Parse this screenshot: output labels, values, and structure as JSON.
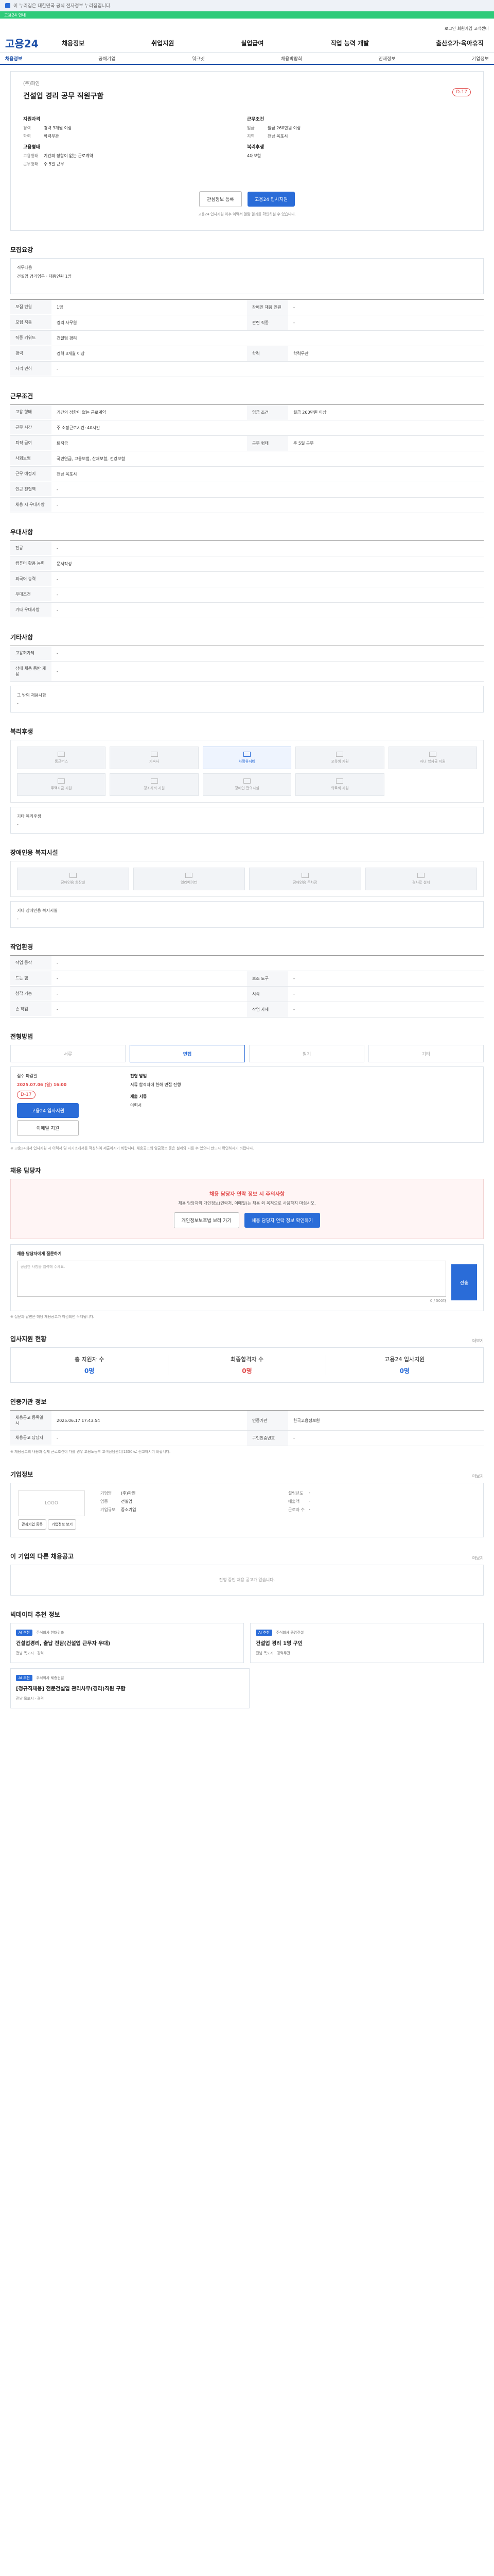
{
  "topbar": {
    "text": "이 누리집은 대한민국 공식 전자정부 누리집입니다."
  },
  "greenbar": {
    "text": "고용24 안내"
  },
  "util": {
    "links": "로그인 회원가입 고객센터"
  },
  "logo": "고용24",
  "gnb": [
    "채용정보",
    "취업지원",
    "실업급여",
    "직업 능력 개발",
    "출산휴가·육아휴직"
  ],
  "subnav": [
    "채용정보",
    "공채기업",
    "워크넷",
    "채용박람회",
    "인재정보",
    "기업정보"
  ],
  "job": {
    "company": "(주)파인",
    "title": "건설업 경리 공무 직원구함",
    "dday": "D-17",
    "left_head": "지원자격",
    "left": [
      {
        "k": "경력",
        "v": "경력 3개월 이상"
      },
      {
        "k": "학력",
        "v": "학력무관"
      }
    ],
    "right_head": "근무조건",
    "right": [
      {
        "k": "임금",
        "v": "월급 260만원 이상"
      },
      {
        "k": "지역",
        "v": "전남 목포시"
      }
    ],
    "left_head2": "고용형태",
    "left2": [
      {
        "k": "고용형태",
        "v": "기간의 정함이 없는 근로계약"
      },
      {
        "k": "근무형태",
        "v": "주 5일 근무"
      }
    ],
    "right_head2": "복리후생",
    "right2": [
      {
        "k": "",
        "v": "4대보험"
      }
    ],
    "btn_scrap": "관심정보 등록",
    "btn_apply": "고용24 입사지원",
    "notice": "고용24 입사지원 이후 이력서 열람 결과를 확인하실 수 있습니다."
  },
  "sec_recruit": {
    "title": "모집요강",
    "desc_label": "직무내용",
    "desc": "건설업 경리업무 · 채용인원 1명",
    "rows": [
      {
        "th": "모집 인원",
        "td": "1명",
        "th2": "장애인 채용 인원",
        "td2": "-"
      },
      {
        "th": "모집 직종",
        "td": "경리 사무원",
        "th2": "관련 직종",
        "td2": "-"
      },
      {
        "th": "직종 키워드",
        "td": "건설업 경리",
        "th2": "",
        "td2": ""
      },
      {
        "th": "경력",
        "td": "경력 3개월 이상",
        "th2": "학력",
        "td2": "학력무관"
      },
      {
        "th": "자격 면허",
        "td": "-",
        "th2": "",
        "td2": ""
      }
    ]
  },
  "sec_condition": {
    "title": "근무조건",
    "rows": [
      {
        "th": "고용 형태",
        "td": "기간의 정함이 없는 근로계약",
        "th2": "임금 조건",
        "td2": "월급 260만원 이상"
      },
      {
        "th": "근무 시간",
        "td": "주 소정근로시간: 40시간",
        "th2": "",
        "td2": ""
      },
      {
        "th": "퇴직 급여",
        "td": "퇴직금",
        "th2": "근무 형태",
        "td2": "주 5일 근무"
      },
      {
        "th": "사회보험",
        "td": "국민연금, 고용보험, 산재보험, 건강보험",
        "th2": "",
        "td2": ""
      },
      {
        "th": "근무 예정지",
        "td": "전남 목포시",
        "th2": "",
        "td2": ""
      },
      {
        "th": "인근 전철역",
        "td": "-",
        "th2": "",
        "td2": ""
      },
      {
        "th": "채용 시 우대사항",
        "td": "-",
        "th2": "",
        "td2": ""
      }
    ]
  },
  "sec_pref": {
    "title": "우대사항",
    "rows": [
      {
        "th": "전공",
        "td": "-"
      },
      {
        "th": "컴퓨터 활용 능력",
        "td": "문서작성"
      },
      {
        "th": "외국어 능력",
        "td": "-"
      },
      {
        "th": "우대조건",
        "td": "-"
      },
      {
        "th": "기타 우대사항",
        "td": "-"
      }
    ]
  },
  "sec_etc": {
    "title": "기타사항",
    "rows": [
      {
        "th": "고용허가제",
        "td": "-"
      },
      {
        "th": "장애 채용 동반 채용",
        "td": "-"
      }
    ],
    "extra_label": "그 밖의 채용사항",
    "extra": "-"
  },
  "sec_welfare": {
    "title": "복리후생",
    "tiles": [
      "통근버스",
      "기숙사",
      "차량유지비",
      "교육비 지원",
      "자녀 학자금 지원",
      "주택자금 지원",
      "경조사비 지원",
      "장애인 편의시설",
      "의료비 지원"
    ],
    "other_label": "기타 복리후생",
    "other": "-"
  },
  "sec_disabled": {
    "title": "장애인용 복지시설",
    "tiles": [
      "장애인용 화장실",
      "엘리베이터",
      "장애인용 주차장",
      "경사로 설치"
    ],
    "other_label": "기타 장애인용 복지시설",
    "other": "-"
  },
  "sec_env": {
    "title": "작업환경",
    "rows": [
      {
        "th": "작업 동작",
        "td": "-",
        "th2": "",
        "td2": ""
      },
      {
        "th": "드는 힘",
        "td": "-",
        "th2": "보조 도구",
        "td2": "-"
      },
      {
        "th": "청각 기능",
        "td": "-",
        "th2": "시각",
        "td2": "-"
      },
      {
        "th": "손 작업",
        "td": "-",
        "th2": "작업 자세",
        "td2": "-"
      }
    ]
  },
  "sec_method": {
    "title": "전형방법",
    "methods": [
      "서류",
      "면접",
      "필기",
      "기타"
    ],
    "deadline_label": "접수 마감일",
    "deadline": "2025.07.06 (일) 16:00",
    "dday": "D-17",
    "apply_btn": "고용24 입사지원",
    "email_btn": "이메일 지원",
    "right_label": "전형 방법",
    "right_text": "서류 합격자에 한해 면접 진행",
    "docs_label": "제출 서류",
    "docs": "이력서",
    "notes": "※ 고용24에서 입사지원 시 이력서 및 자기소개서를 작성하여 제출하시기 바랍니다. 채용공고의 임금정보 등은 실제와 다를 수 있으니 반드시 확인하시기 바랍니다."
  },
  "sec_contact": {
    "title": "채용 담당자",
    "warn_title": "채용 담당자 연락 정보 시 주의사항",
    "warn_text": "채용 담당자의 개인정보(연락처, 이메일)는 채용 외 목적으로 사용하지 마십시오.",
    "btn_view": "개인정보보호법 보러 가기",
    "btn_contact": "채용 담당자 연락 정보 확인하기",
    "msg_label": "채용 담당자에게 질문하기",
    "msg_count": "0 / 500자",
    "msg_placeholder": "궁금한 사항을 입력해 주세요.",
    "send": "전송",
    "notes": "※ 질문과 답변은 해당 채용공고가 마감되면 삭제됩니다."
  },
  "sec_stats": {
    "title": "입사지원 현황",
    "more": "더보기",
    "stats": [
      {
        "k": "총 지원자 수",
        "v": "0명"
      },
      {
        "k": "최종합격자 수",
        "v": "0명"
      },
      {
        "k": "고용24 입사지원",
        "v": "0명"
      }
    ]
  },
  "sec_info": {
    "title": "인증기관 정보",
    "rows": [
      {
        "th": "채용공고 등록일시",
        "td": "2025.06.17 17:43:54",
        "th2": "인증기관",
        "td2": "한국고용정보원"
      },
      {
        "th": "채용공고 담당자",
        "td": "-",
        "th2": "구인인증번호",
        "td2": "-"
      }
    ],
    "notes": "※ 채용공고의 내용과 실제 근로조건이 다를 경우 고용노동부 고객상담센터(1350)로 신고하시기 바랍니다."
  },
  "sec_company": {
    "title": "기업정보",
    "more": "더보기",
    "logo": "LOGO",
    "btns": [
      "관심기업 등록",
      "기업정보 보기"
    ],
    "left": [
      {
        "k": "기업명",
        "v": "(주)파인"
      },
      {
        "k": "업종",
        "v": "건설업"
      },
      {
        "k": "기업규모",
        "v": "중소기업"
      }
    ],
    "right": [
      {
        "k": "설립년도",
        "v": "-"
      },
      {
        "k": "매출액",
        "v": "-"
      },
      {
        "k": "근로자 수",
        "v": "-"
      }
    ]
  },
  "sec_other": {
    "title": "이 기업의 다른 채용공고",
    "more": "더보기",
    "empty": "진행 중인 채용 공고가 없습니다."
  },
  "sec_reco": {
    "title": "빅데이터 추천 정보",
    "cards": [
      {
        "tag": "AI 추천",
        "company": "주식회사 한대건축",
        "title": "건설업경리, 출납 전담(건설업 근무자 우대)",
        "meta": "전남 목포시 · 경력"
      },
      {
        "tag": "AI 추천",
        "company": "주식회사 중앙건설",
        "title": "건설업 경리 1명 구인",
        "meta": "전남 목포시 · 경력무관"
      }
    ],
    "card3": {
      "tag": "AI 추천",
      "company": "주식회사 세종건설",
      "title": "[정규직채용] 전문건설업 관리사무(경리)직원 구함",
      "meta": "전남 목포시 · 경력"
    }
  }
}
